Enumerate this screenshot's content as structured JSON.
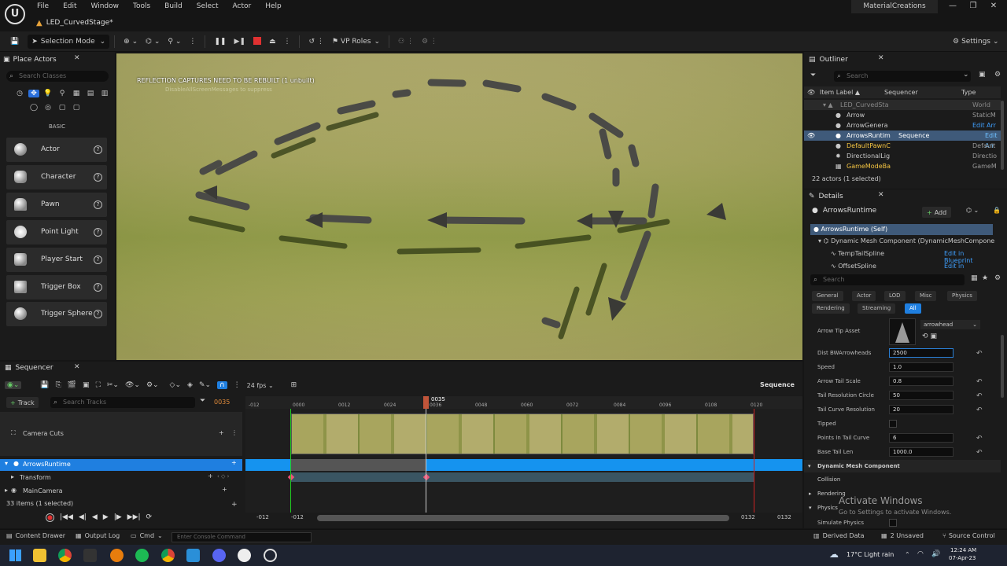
{
  "window": {
    "menu": [
      "File",
      "Edit",
      "Window",
      "Tools",
      "Build",
      "Select",
      "Actor",
      "Help"
    ],
    "level_tab": "LED_CurvedStage*",
    "project_name": "MaterialCreations"
  },
  "toolbar": {
    "selection_mode": "Selection Mode",
    "vp_roles": "VP Roles",
    "settings": "Settings"
  },
  "place_actors": {
    "tab": "Place Actors",
    "search_placeholder": "Search Classes",
    "category": "BASIC",
    "items": [
      "Actor",
      "Character",
      "Pawn",
      "Point Light",
      "Player Start",
      "Trigger Box",
      "Trigger Sphere"
    ]
  },
  "viewport": {
    "message": "REFLECTION CAPTURES NEED TO BE REBUILT (1 unbuilt)",
    "sub_message": "DisableAllScreenMessages to suppress"
  },
  "outliner": {
    "tab": "Outliner",
    "search_placeholder": "Search",
    "columns": [
      "Item Label ▲",
      "Sequencer",
      "Type"
    ],
    "rows": [
      {
        "label": "LED_CurvedSta",
        "seq": "",
        "type": "World",
        "indent": 2
      },
      {
        "label": "Arrow",
        "seq": "",
        "type": "StaticM",
        "indent": 3
      },
      {
        "label": "ArrowGenera",
        "seq": "",
        "type": "Edit Arr",
        "indent": 3
      },
      {
        "label": "ArrowsRuntim",
        "seq": "Sequence",
        "type": "Edit Arr",
        "indent": 3
      },
      {
        "label": "DefaultPawnC",
        "seq": "",
        "type": "Default",
        "indent": 3
      },
      {
        "label": "DirectionalLig",
        "seq": "",
        "type": "Directio",
        "indent": 3
      },
      {
        "label": "GameModeBa",
        "seq": "",
        "type": "GameM",
        "indent": 3
      }
    ],
    "count": "22 actors (1 selected)"
  },
  "details": {
    "tab": "Details",
    "actor": "ArrowsRuntime",
    "add": "Add",
    "components": [
      {
        "label": "ArrowsRuntime (Self)",
        "link": ""
      },
      {
        "label": "Dynamic Mesh Component (DynamicMeshCompone",
        "link": ""
      },
      {
        "label": "TempTailSpline",
        "link": "Edit in Blueprint"
      },
      {
        "label": "OffsetSpline",
        "link": "Edit in Blueprint"
      }
    ],
    "search_placeholder": "Search",
    "categories_row1": [
      "General",
      "Actor",
      "LOD",
      "Misc",
      "Physics"
    ],
    "categories_row2": [
      "Rendering",
      "Streaming",
      "All"
    ],
    "arrow_tip_label": "Arrow Tip Asset",
    "arrow_tip_value": "arrowhead",
    "props": [
      {
        "label": "Dist BWArrowheads",
        "value": "2500"
      },
      {
        "label": "Speed",
        "value": "1.0"
      },
      {
        "label": "Arrow Tail Scale",
        "value": "0.8"
      },
      {
        "label": "Tail Resolution Circle",
        "value": "50"
      },
      {
        "label": "Tail Curve Resolution",
        "value": "20"
      },
      {
        "label": "Tipped",
        "value": ""
      },
      {
        "label": "Points In Tail Curve",
        "value": "6"
      },
      {
        "label": "Base Tail Len",
        "value": "1000.0"
      }
    ],
    "section": "Dynamic Mesh Component",
    "sub_sections": [
      "Collision",
      "Rendering",
      "Physics"
    ],
    "simulate_physics": "Simulate Physics",
    "watermark_title": "Activate Windows",
    "watermark_sub": "Go to Settings to activate Windows."
  },
  "sequencer": {
    "tab": "Sequencer",
    "fps": "24 fps",
    "title": "Sequence",
    "track_button": "Track",
    "search_placeholder": "Search Tracks",
    "frame_field": "0035",
    "playhead": "0035",
    "ruler": [
      "-012",
      "0000",
      "0012",
      "0024",
      "0036",
      "0048",
      "0060",
      "0072",
      "0084",
      "0096",
      "0108",
      "0120"
    ],
    "tracks": [
      "Camera Cuts",
      "ArrowsRuntime",
      "Transform",
      "MainCamera"
    ],
    "items_count": "33 items (1 selected)",
    "bottom_start": "-012",
    "bottom_start2": "-012",
    "bottom_end": "0132",
    "bottom_end2": "0132"
  },
  "statusbar": {
    "content_drawer": "Content Drawer",
    "output_log": "Output Log",
    "cmd": "Cmd",
    "console_placeholder": "Enter Console Command",
    "derived_data": "Derived Data",
    "unsaved": "2 Unsaved",
    "source_control": "Source Control"
  },
  "taskbar": {
    "weather": "17°C  Light rain",
    "time": "12:24 AM",
    "date": "07-Apr-23"
  }
}
